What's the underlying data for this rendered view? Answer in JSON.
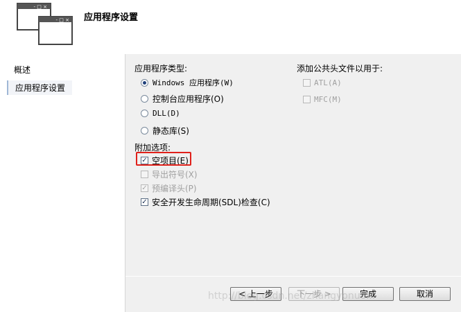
{
  "header": {
    "title": "应用程序设置"
  },
  "sidebar": {
    "items": [
      {
        "label": "概述"
      },
      {
        "label": "应用程序设置"
      }
    ]
  },
  "app_type": {
    "label": "应用程序类型:",
    "options": [
      {
        "label": "Windows 应用程序(W)",
        "checked": true
      },
      {
        "label": "控制台应用程序(O)",
        "checked": false
      },
      {
        "label": "DLL(D)",
        "checked": false
      },
      {
        "label": "静态库(S)",
        "checked": false
      }
    ]
  },
  "extra_options": {
    "label": "附加选项:",
    "items": [
      {
        "label": "空项目(E)",
        "checked": true,
        "enabled": true
      },
      {
        "label": "导出符号(X)",
        "checked": false,
        "enabled": false
      },
      {
        "label": "预编译头(P)",
        "checked": true,
        "enabled": false
      },
      {
        "label": "安全开发生命周期(SDL)检查(C)",
        "checked": true,
        "enabled": true
      }
    ]
  },
  "headers": {
    "label": "添加公共头文件以用于:",
    "items": [
      {
        "label": "ATL(A)",
        "checked": false,
        "enabled": false
      },
      {
        "label": "MFC(M)",
        "checked": false,
        "enabled": false
      }
    ]
  },
  "buttons": {
    "back": "< 上一步",
    "next": "下一步 >",
    "finish": "完成",
    "cancel": "取消"
  },
  "watermark": "http://blog.csdn.net/zhangyonuo..."
}
